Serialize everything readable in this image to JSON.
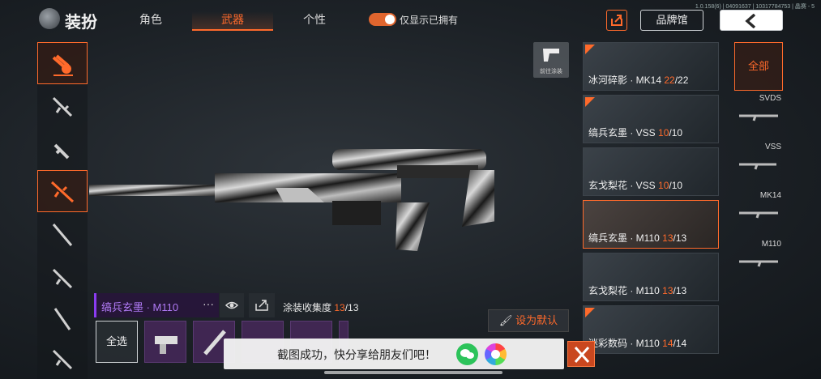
{
  "header": {
    "title": "装扮",
    "tabs": [
      {
        "label": "角色",
        "active": false
      },
      {
        "label": "武器",
        "active": true
      },
      {
        "label": "个性",
        "active": false
      }
    ],
    "owned_only_toggle": {
      "label": "仅显示已拥有",
      "on": true
    },
    "version": "1.0.158(6) | 04091637 | 10317784753 | 晶赛 - 5",
    "brand_hall_label": "品牌馆"
  },
  "left_categories": [
    {
      "icon": "weapon-skin-badge-icon",
      "active": true
    },
    {
      "icon": "assault-rifle-icon",
      "active": false
    },
    {
      "icon": "smg-icon",
      "active": false
    },
    {
      "icon": "sniper-rifle-icon",
      "active": true
    },
    {
      "icon": "shotgun-icon",
      "active": false
    },
    {
      "icon": "rifle-icon",
      "active": false
    },
    {
      "icon": "marksman-rifle-icon",
      "active": false
    },
    {
      "icon": "pistol-icon",
      "active": false
    }
  ],
  "goto_paint": {
    "label": "前往涂装"
  },
  "skins": [
    {
      "name": "冰河碎影 · MK14 ",
      "count": "22",
      "total": "/22",
      "tag": true,
      "selected": false
    },
    {
      "name": "缟兵玄墨 · VSS ",
      "count": "10",
      "total": "/10",
      "tag": true,
      "selected": false
    },
    {
      "name": "玄戈梨花 · VSS ",
      "count": "10",
      "total": "/10",
      "tag": false,
      "selected": false
    },
    {
      "name": "缟兵玄墨 · M110 ",
      "count": "13",
      "total": "/13",
      "tag": false,
      "selected": true
    },
    {
      "name": "玄戈梨花 · M110 ",
      "count": "13",
      "total": "/13",
      "tag": false,
      "selected": false
    },
    {
      "name": "迷彩数码 · M110 ",
      "count": "14",
      "total": "/14",
      "tag": true,
      "selected": false
    }
  ],
  "filters": {
    "all_label": "全部",
    "items": [
      {
        "label": "SVDS"
      },
      {
        "label": "VSS"
      },
      {
        "label": "MK14"
      },
      {
        "label": "M110"
      }
    ]
  },
  "current_skin": {
    "name": "缟兵玄墨 · M110",
    "more": "···",
    "collection_label": "涂装收集度 ",
    "collection_current": "13",
    "collection_total": "/13"
  },
  "set_default_label": "设为默认",
  "select_all_label": "全选",
  "toast": {
    "text": "截图成功，快分享给朋友们吧！"
  },
  "colors": {
    "accent": "#ff6a2b",
    "purple": "#8a3cf0"
  }
}
